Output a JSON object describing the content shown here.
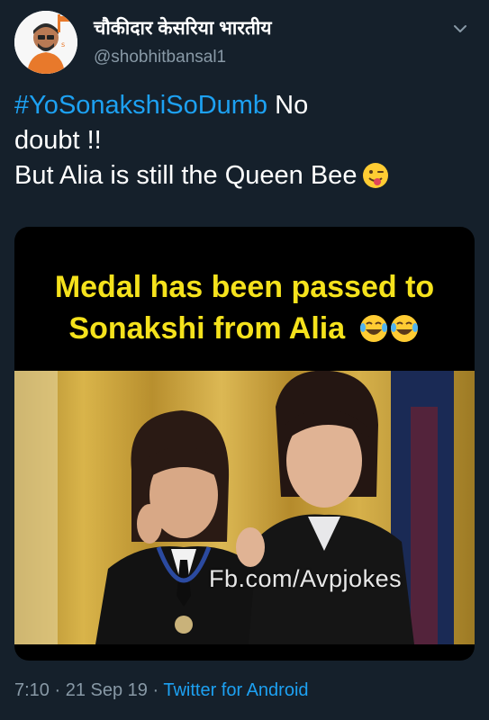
{
  "user": {
    "display_name": "चौकीदार केसरिया भारतीय",
    "handle": "@shobhitbansal1"
  },
  "tweet": {
    "hashtag": "#YoSonakshiSoDumb",
    "text_after_hashtag": " No",
    "line2": "doubt !!",
    "line3": "But Alia is still the Queen Bee",
    "emoji_icon": "winking-face-tongue-icon"
  },
  "media": {
    "caption_line1": "Medal has been passed to",
    "caption_line2": "Sonakshi from Alia",
    "caption_emoji_icon": "tears-of-joy-icon",
    "watermark": "Fb.com/Avpjokes"
  },
  "meta": {
    "time": "7:10",
    "date": "21 Sep 19",
    "separator": " · ",
    "source": "Twitter for Android"
  },
  "colors": {
    "background": "#15202b",
    "link": "#1da1f2",
    "secondary_text": "#8899a6",
    "caption_yellow": "#f5e21c"
  }
}
